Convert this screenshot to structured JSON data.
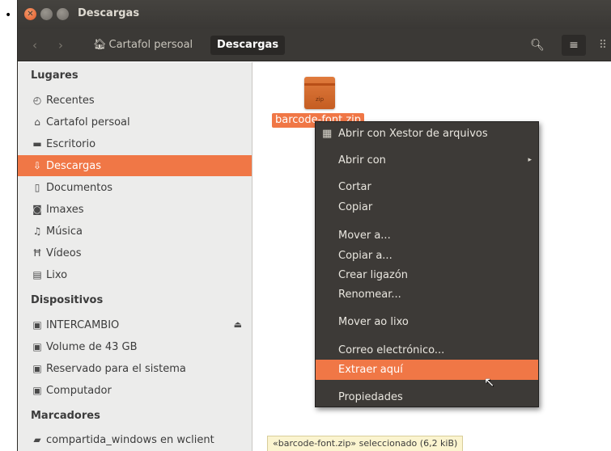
{
  "page": {
    "bullet": "•"
  },
  "window": {
    "title": "Descargas",
    "controls": {
      "close": "✕",
      "min": "",
      "max": ""
    }
  },
  "toolbar": {
    "back_glyph": "‹",
    "forward_glyph": "›",
    "breadcrumbs": [
      {
        "label": "Cartafol persoal",
        "icon": "home-icon",
        "glyph": "🏠︎"
      },
      {
        "label": "Descargas"
      }
    ],
    "search_glyph": "🔍︎",
    "list_glyph": "≡",
    "grid_glyph": "⠿"
  },
  "sidebar": {
    "sections": [
      {
        "title": "Lugares"
      },
      {
        "title": "Dispositivos"
      },
      {
        "title": "Marcadores"
      }
    ],
    "items": [
      {
        "label": "Recentes",
        "icon": "clock-icon",
        "glyph": "◴"
      },
      {
        "label": "Cartafol persoal",
        "icon": "home-icon",
        "glyph": "⌂"
      },
      {
        "label": "Escritorio",
        "icon": "folder-icon",
        "glyph": "▬"
      },
      {
        "label": "Descargas",
        "icon": "download-icon",
        "glyph": "⇩",
        "active": true
      },
      {
        "label": "Documentos",
        "icon": "document-icon",
        "glyph": "▯"
      },
      {
        "label": "Imaxes",
        "icon": "camera-icon",
        "glyph": "◙"
      },
      {
        "label": "Música",
        "icon": "music-icon",
        "glyph": "♫"
      },
      {
        "label": "Vídeos",
        "icon": "film-icon",
        "glyph": "Ħ"
      },
      {
        "label": "Lixo",
        "icon": "trash-icon",
        "glyph": "▤"
      },
      {
        "label": "INTERCAMBIO",
        "icon": "drive-icon",
        "glyph": "▣",
        "eject": "⏏"
      },
      {
        "label": "Volume de 43 GB",
        "icon": "drive-icon",
        "glyph": "▣"
      },
      {
        "label": "Reservado para el sistema",
        "icon": "drive-icon",
        "glyph": "▣"
      },
      {
        "label": "Computador",
        "icon": "drive-icon",
        "glyph": "▣"
      },
      {
        "label": "compartida_windows en wclient",
        "icon": "network-folder-icon",
        "glyph": "▰"
      }
    ]
  },
  "files": [
    {
      "name": "barcode-font.zip",
      "type_label": "zip",
      "selected": true
    }
  ],
  "context_menu": {
    "items": [
      {
        "label": "Abrir con Xestor de arquivos",
        "icon": "archive-manager-icon",
        "glyph": "▦"
      },
      {
        "label": "Abrir con",
        "submenu_glyph": "▸"
      },
      {
        "label": "Cortar"
      },
      {
        "label": "Copiar"
      },
      {
        "label": "Mover a..."
      },
      {
        "label": "Copiar a..."
      },
      {
        "label": "Crear ligazón"
      },
      {
        "label": "Renomear..."
      },
      {
        "label": "Mover ao lixo"
      },
      {
        "label": "Correo electrónico..."
      },
      {
        "label": "Extraer aquí",
        "highlighted": true
      },
      {
        "label": "Propiedades"
      }
    ],
    "cursor_glyph": "↖"
  },
  "status": {
    "text": "«barcode-font.zip» seleccionado  (6,2 kiB)"
  },
  "colors": {
    "accent": "#f07746",
    "titlebar": "#3d3b37",
    "menu_bg": "#3d3a37"
  }
}
